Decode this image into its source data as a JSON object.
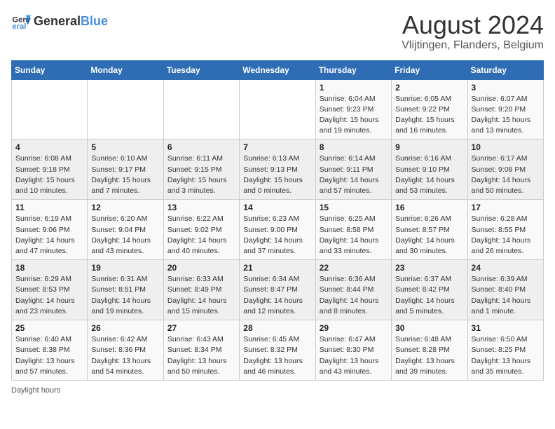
{
  "header": {
    "logo_general": "General",
    "logo_blue": "Blue",
    "main_title": "August 2024",
    "subtitle": "Vlijtingen, Flanders, Belgium"
  },
  "calendar": {
    "days_of_week": [
      "Sunday",
      "Monday",
      "Tuesday",
      "Wednesday",
      "Thursday",
      "Friday",
      "Saturday"
    ],
    "weeks": [
      [
        {
          "day": "",
          "text": ""
        },
        {
          "day": "",
          "text": ""
        },
        {
          "day": "",
          "text": ""
        },
        {
          "day": "",
          "text": ""
        },
        {
          "day": "1",
          "text": "Sunrise: 6:04 AM\nSunset: 9:23 PM\nDaylight: 15 hours and 19 minutes."
        },
        {
          "day": "2",
          "text": "Sunrise: 6:05 AM\nSunset: 9:22 PM\nDaylight: 15 hours and 16 minutes."
        },
        {
          "day": "3",
          "text": "Sunrise: 6:07 AM\nSunset: 9:20 PM\nDaylight: 15 hours and 13 minutes."
        }
      ],
      [
        {
          "day": "4",
          "text": "Sunrise: 6:08 AM\nSunset: 9:18 PM\nDaylight: 15 hours and 10 minutes."
        },
        {
          "day": "5",
          "text": "Sunrise: 6:10 AM\nSunset: 9:17 PM\nDaylight: 15 hours and 7 minutes."
        },
        {
          "day": "6",
          "text": "Sunrise: 6:11 AM\nSunset: 9:15 PM\nDaylight: 15 hours and 3 minutes."
        },
        {
          "day": "7",
          "text": "Sunrise: 6:13 AM\nSunset: 9:13 PM\nDaylight: 15 hours and 0 minutes."
        },
        {
          "day": "8",
          "text": "Sunrise: 6:14 AM\nSunset: 9:11 PM\nDaylight: 14 hours and 57 minutes."
        },
        {
          "day": "9",
          "text": "Sunrise: 6:16 AM\nSunset: 9:10 PM\nDaylight: 14 hours and 53 minutes."
        },
        {
          "day": "10",
          "text": "Sunrise: 6:17 AM\nSunset: 9:08 PM\nDaylight: 14 hours and 50 minutes."
        }
      ],
      [
        {
          "day": "11",
          "text": "Sunrise: 6:19 AM\nSunset: 9:06 PM\nDaylight: 14 hours and 47 minutes."
        },
        {
          "day": "12",
          "text": "Sunrise: 6:20 AM\nSunset: 9:04 PM\nDaylight: 14 hours and 43 minutes."
        },
        {
          "day": "13",
          "text": "Sunrise: 6:22 AM\nSunset: 9:02 PM\nDaylight: 14 hours and 40 minutes."
        },
        {
          "day": "14",
          "text": "Sunrise: 6:23 AM\nSunset: 9:00 PM\nDaylight: 14 hours and 37 minutes."
        },
        {
          "day": "15",
          "text": "Sunrise: 6:25 AM\nSunset: 8:58 PM\nDaylight: 14 hours and 33 minutes."
        },
        {
          "day": "16",
          "text": "Sunrise: 6:26 AM\nSunset: 8:57 PM\nDaylight: 14 hours and 30 minutes."
        },
        {
          "day": "17",
          "text": "Sunrise: 6:28 AM\nSunset: 8:55 PM\nDaylight: 14 hours and 26 minutes."
        }
      ],
      [
        {
          "day": "18",
          "text": "Sunrise: 6:29 AM\nSunset: 8:53 PM\nDaylight: 14 hours and 23 minutes."
        },
        {
          "day": "19",
          "text": "Sunrise: 6:31 AM\nSunset: 8:51 PM\nDaylight: 14 hours and 19 minutes."
        },
        {
          "day": "20",
          "text": "Sunrise: 6:33 AM\nSunset: 8:49 PM\nDaylight: 14 hours and 15 minutes."
        },
        {
          "day": "21",
          "text": "Sunrise: 6:34 AM\nSunset: 8:47 PM\nDaylight: 14 hours and 12 minutes."
        },
        {
          "day": "22",
          "text": "Sunrise: 6:36 AM\nSunset: 8:44 PM\nDaylight: 14 hours and 8 minutes."
        },
        {
          "day": "23",
          "text": "Sunrise: 6:37 AM\nSunset: 8:42 PM\nDaylight: 14 hours and 5 minutes."
        },
        {
          "day": "24",
          "text": "Sunrise: 6:39 AM\nSunset: 8:40 PM\nDaylight: 14 hours and 1 minute."
        }
      ],
      [
        {
          "day": "25",
          "text": "Sunrise: 6:40 AM\nSunset: 8:38 PM\nDaylight: 13 hours and 57 minutes."
        },
        {
          "day": "26",
          "text": "Sunrise: 6:42 AM\nSunset: 8:36 PM\nDaylight: 13 hours and 54 minutes."
        },
        {
          "day": "27",
          "text": "Sunrise: 6:43 AM\nSunset: 8:34 PM\nDaylight: 13 hours and 50 minutes."
        },
        {
          "day": "28",
          "text": "Sunrise: 6:45 AM\nSunset: 8:32 PM\nDaylight: 13 hours and 46 minutes."
        },
        {
          "day": "29",
          "text": "Sunrise: 6:47 AM\nSunset: 8:30 PM\nDaylight: 13 hours and 43 minutes."
        },
        {
          "day": "30",
          "text": "Sunrise: 6:48 AM\nSunset: 8:28 PM\nDaylight: 13 hours and 39 minutes."
        },
        {
          "day": "31",
          "text": "Sunrise: 6:50 AM\nSunset: 8:25 PM\nDaylight: 13 hours and 35 minutes."
        }
      ]
    ]
  },
  "footer": {
    "note": "Daylight hours"
  }
}
